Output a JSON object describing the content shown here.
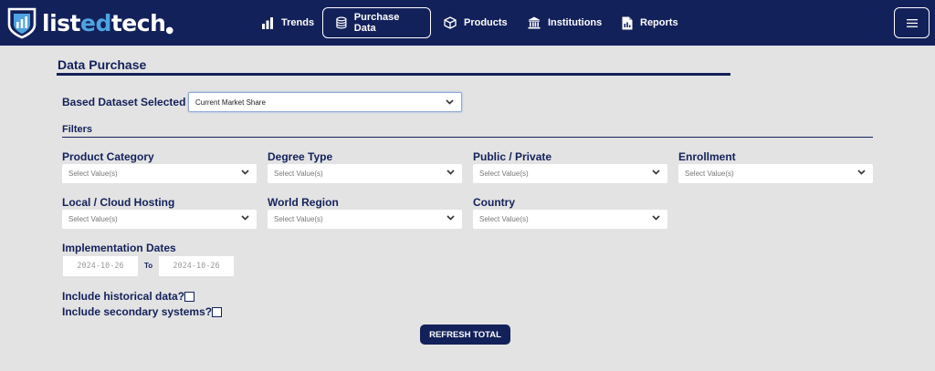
{
  "brand": {
    "part1": "list",
    "part2": "ed",
    "part3": "tech",
    "dot": "●"
  },
  "nav": {
    "trends": "Trends",
    "purchase_data": "Purchase Data",
    "products": "Products",
    "institutions": "Institutions",
    "reports": "Reports",
    "menu_icon": "hamburger-icon"
  },
  "page": {
    "title": "Data Purchase"
  },
  "dataset": {
    "label": "Based Dataset Selected",
    "value": "Current Market Share"
  },
  "filters": {
    "heading": "Filters",
    "placeholder": "Select Value(s)",
    "product_category": "Product Category",
    "degree_type": "Degree Type",
    "public_private": "Public / Private",
    "enrollment": "Enrollment",
    "hosting": "Local / Cloud Hosting",
    "world_region": "World Region",
    "country": "Country"
  },
  "implementation": {
    "label": "Implementation Dates",
    "from": "2024-10-26",
    "to_label": "To",
    "to": "2024-10-26"
  },
  "options": {
    "historical": "Include historical data?",
    "secondary": "Include secondary systems?"
  },
  "actions": {
    "refresh": "REFRESH TOTAL"
  },
  "colors": {
    "navy": "#13215a",
    "accent": "#4fa3e0",
    "background": "#e3e3e3"
  }
}
